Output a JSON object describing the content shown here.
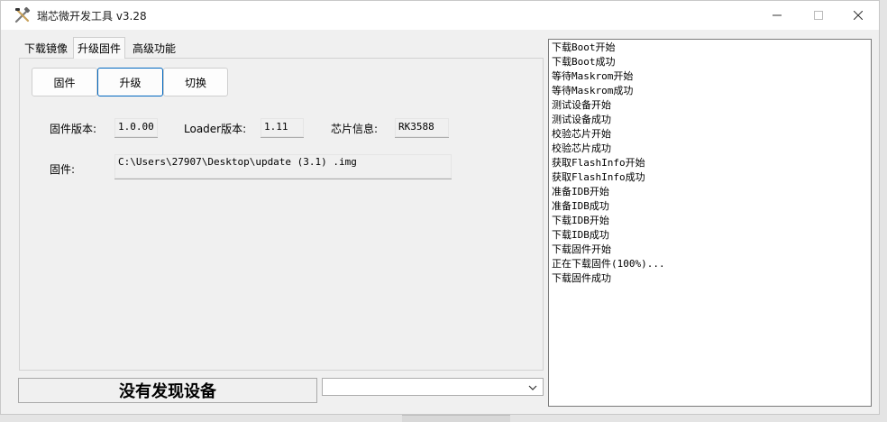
{
  "window": {
    "title": "瑞芯微开发工具 v3.28",
    "icon": "tools-icon"
  },
  "tabs": [
    {
      "label": "下载镜像"
    },
    {
      "label": "升级固件",
      "active": true
    },
    {
      "label": "高级功能"
    }
  ],
  "subtabs": [
    {
      "label": "固件"
    },
    {
      "label": "升级",
      "active": true
    },
    {
      "label": "切换"
    }
  ],
  "info": {
    "firmware_version_label": "固件版本:",
    "firmware_version": "1.0.00",
    "loader_version_label": "Loader版本:",
    "loader_version": "1.11",
    "chip_info_label": "芯片信息:",
    "chip_info": "RK3588"
  },
  "firmware": {
    "label": "固件:",
    "path": "C:\\Users\\27907\\Desktop\\update (3.1) .img"
  },
  "status": {
    "text": "没有发现设备"
  },
  "device_select": {
    "value": ""
  },
  "log": [
    "下载Boot开始",
    "下载Boot成功",
    "等待Maskrom开始",
    "等待Maskrom成功",
    "测试设备开始",
    "测试设备成功",
    "校验芯片开始",
    "校验芯片成功",
    "获取FlashInfo开始",
    "获取FlashInfo成功",
    "准备IDB开始",
    "准备IDB成功",
    "下载IDB开始",
    "下载IDB成功",
    "下载固件开始",
    "正在下载固件(100%)...",
    "下载固件成功"
  ],
  "colors": {
    "accent": "#0067c0",
    "window_bg": "#f0f0f0"
  }
}
